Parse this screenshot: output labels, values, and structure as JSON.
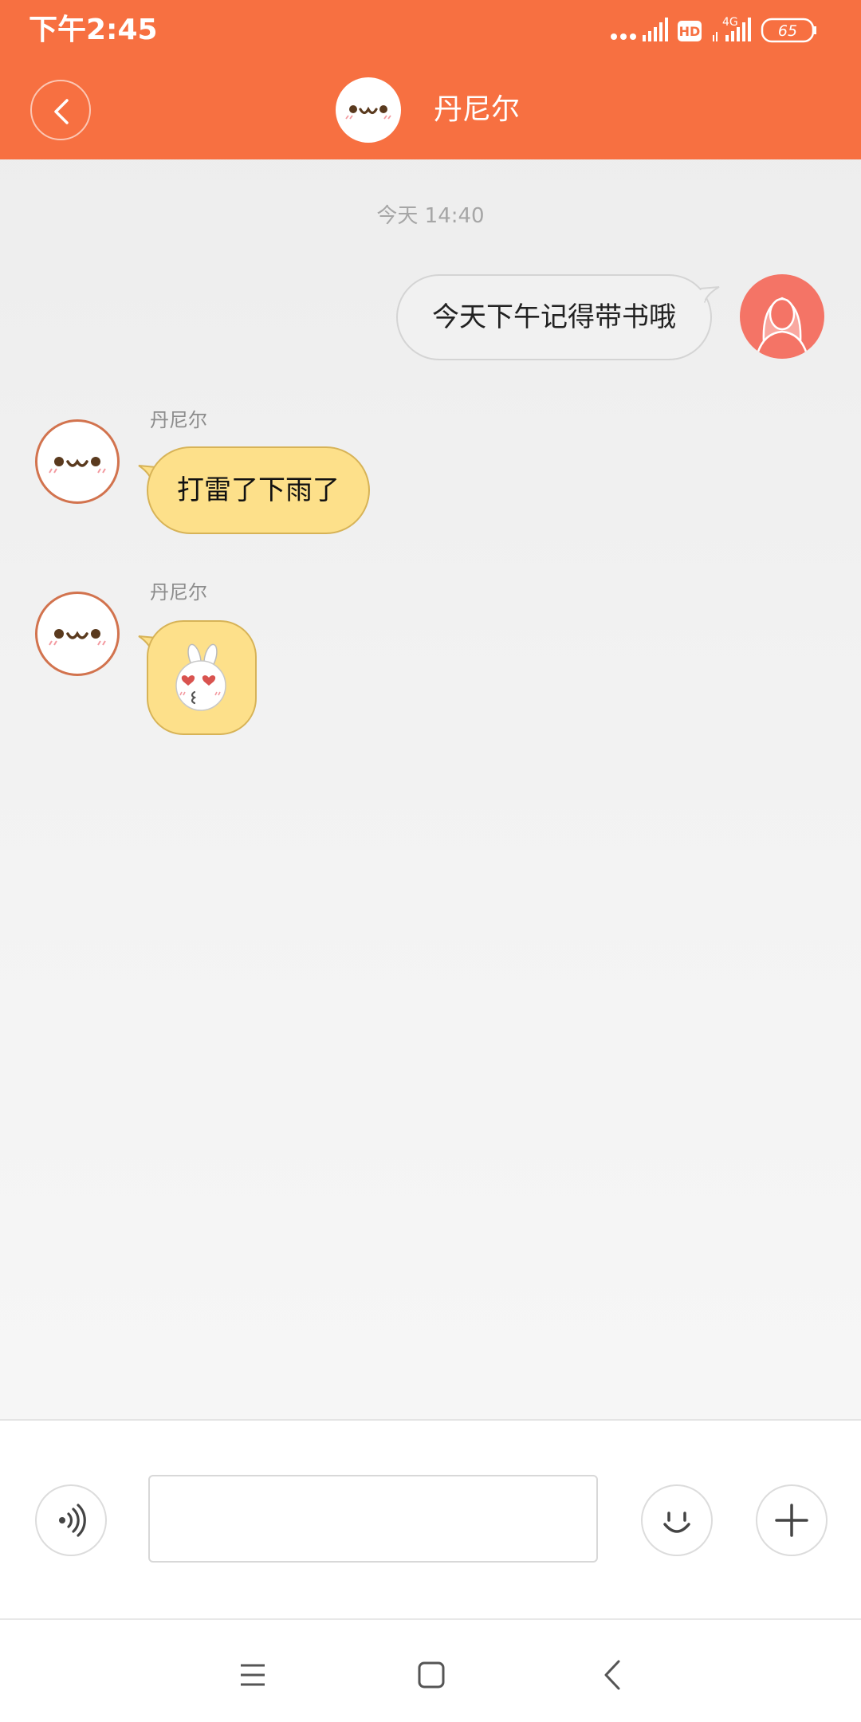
{
  "status_bar": {
    "time": "下午2:45",
    "hd_label": "HD",
    "network_label": "4G",
    "battery": "65"
  },
  "header": {
    "title": "丹尼尔",
    "back_icon": "chevron-left-icon",
    "avatar": "kaomoji-face-avatar",
    "bg_color": "#f77041"
  },
  "chat": {
    "timestamp": "今天 14:40",
    "messages": [
      {
        "direction": "outgoing",
        "type": "text",
        "text": "今天下午记得带书哦",
        "avatar": "woman-silhouette-avatar"
      },
      {
        "direction": "incoming",
        "type": "text",
        "sender": "丹尼尔",
        "text": "打雷了下雨了",
        "avatar": "kaomoji-face-avatar"
      },
      {
        "direction": "incoming",
        "type": "sticker",
        "sender": "丹尼尔",
        "sticker": "heart-eyes-bunny-sticker",
        "avatar": "kaomoji-face-avatar"
      }
    ],
    "outgoing_bubble_color": "#f1f1f1",
    "incoming_bubble_color": "#fde08a"
  },
  "input_bar": {
    "voice_icon": "voice-icon",
    "emoji_icon": "smiley-icon",
    "plus_icon": "plus-icon",
    "input_value": "",
    "input_placeholder": ""
  },
  "nav_bar": {
    "menu_icon": "menu-icon",
    "home_icon": "home-square-icon",
    "back_icon": "back-triangle-icon"
  }
}
